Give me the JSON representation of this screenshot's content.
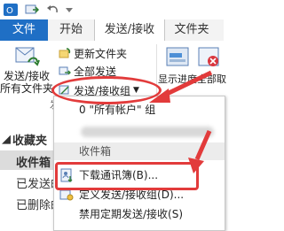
{
  "tabs": [
    {
      "label": "文件"
    },
    {
      "label": "开始"
    },
    {
      "label": "发送/接收"
    },
    {
      "label": "文件夹"
    }
  ],
  "ribbon": {
    "send_receive_all": {
      "line1": "发送/接收",
      "line2": "所有文件夹"
    },
    "update_folder": "更新文件夹",
    "send_all": "全部发送",
    "send_receive_groups": "发送/接收组",
    "group_label_partial": "发",
    "show_progress": "显示进度",
    "cancel_all_partial": "全部取"
  },
  "pane": {
    "favorites_partial": "收藏夹",
    "inbox_partial": "收件箱",
    "sent_partial": "已发送邮",
    "deleted_partial": "已删除邮"
  },
  "menu": {
    "all_accounts_item": "0 \"所有帐户\" 组",
    "inbox_section": "收件箱",
    "download_address_book": "下载通讯簿(B)...",
    "define_groups": "定义发送/接收组(D)...",
    "disable_scheduled": "禁用定期发送/接收(S)"
  },
  "colors": {
    "file_tab": "#1f6fc5",
    "annotation_red": "#e23b3b"
  }
}
